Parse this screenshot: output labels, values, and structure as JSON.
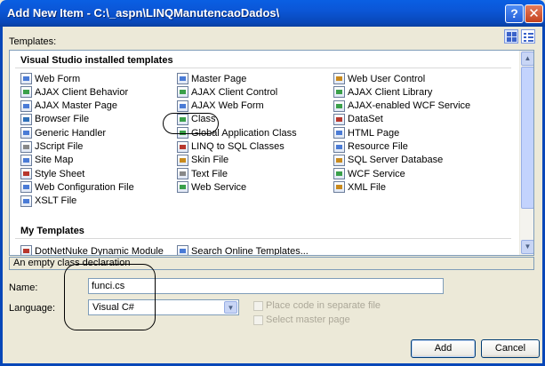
{
  "window": {
    "title": "Add New Item - C:\\_aspn\\LINQManutencaoDados\\",
    "help_label": "?",
    "close_label": "✕"
  },
  "templates": {
    "label": "Templates:",
    "installed_header": "Visual Studio installed templates",
    "my_header": "My Templates",
    "items": [
      {
        "label": "Web Form",
        "color": "#4a7bd6"
      },
      {
        "label": "Master Page",
        "color": "#4a7bd6"
      },
      {
        "label": "Web User Control",
        "color": "#c98a1d"
      },
      {
        "label": "AJAX Client Behavior",
        "color": "#3aa04a"
      },
      {
        "label": "AJAX Client Control",
        "color": "#3aa04a"
      },
      {
        "label": "AJAX Client Library",
        "color": "#3aa04a"
      },
      {
        "label": "AJAX Master Page",
        "color": "#4a7bd6"
      },
      {
        "label": "AJAX Web Form",
        "color": "#4a7bd6"
      },
      {
        "label": "AJAX-enabled WCF Service",
        "color": "#3aa04a"
      },
      {
        "label": "Browser File",
        "color": "#2d6fb8"
      },
      {
        "label": "Class",
        "color": "#3aa04a"
      },
      {
        "label": "DataSet",
        "color": "#b8372d"
      },
      {
        "label": "Generic Handler",
        "color": "#4a7bd6"
      },
      {
        "label": "Global Application Class",
        "color": "#3aa04a"
      },
      {
        "label": "HTML Page",
        "color": "#4a7bd6"
      },
      {
        "label": "JScript File",
        "color": "#888888"
      },
      {
        "label": "LINQ to SQL Classes",
        "color": "#b8372d"
      },
      {
        "label": "Resource File",
        "color": "#4a7bd6"
      },
      {
        "label": "Site Map",
        "color": "#4a7bd6"
      },
      {
        "label": "Skin File",
        "color": "#c98a1d"
      },
      {
        "label": "SQL Server Database",
        "color": "#c98a1d"
      },
      {
        "label": "Style Sheet",
        "color": "#b8372d"
      },
      {
        "label": "Text File",
        "color": "#888888"
      },
      {
        "label": "WCF Service",
        "color": "#3aa04a"
      },
      {
        "label": "Web Configuration File",
        "color": "#4a7bd6"
      },
      {
        "label": "Web Service",
        "color": "#3aa04a"
      },
      {
        "label": "XML File",
        "color": "#c98a1d"
      },
      {
        "label": "XSLT File",
        "color": "#4a7bd6"
      }
    ],
    "my_items": [
      {
        "label": "DotNetNuke Dynamic Module",
        "color": "#b8372d"
      },
      {
        "label": "Search Online Templates...",
        "color": "#4a7bd6"
      }
    ]
  },
  "description": "An empty class declaration",
  "name_field": {
    "label": "Name:",
    "value": "funci.cs"
  },
  "language_field": {
    "label": "Language:",
    "value": "Visual C#"
  },
  "options": {
    "separate_file_label": "Place code in separate file",
    "master_page_label": "Select master page"
  },
  "buttons": {
    "add": "Add",
    "cancel": "Cancel"
  }
}
